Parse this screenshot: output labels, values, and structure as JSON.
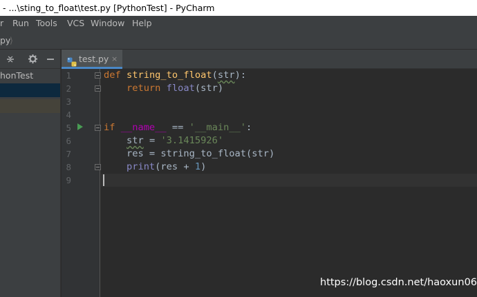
{
  "window": {
    "title": "- ...\\sting_to_float\\test.py [PythonTest] - PyCharm"
  },
  "menu": {
    "items": [
      "r",
      "Run",
      "Tools",
      "VCS",
      "Window",
      "Help"
    ]
  },
  "navbar": {
    "crumb": "py",
    "separator": "⟩"
  },
  "project": {
    "toolbar_icons": [
      "split-icon",
      "gear-icon",
      "minimize-icon"
    ],
    "root_label": "honTest"
  },
  "editor": {
    "tab_label": "test.py",
    "tab_close": "×",
    "line_numbers": [
      "1",
      "2",
      "3",
      "4",
      "5",
      "6",
      "7",
      "8",
      "9"
    ],
    "code": {
      "l1": {
        "kw": "def",
        "fn": "string_to_float",
        "p1": "(",
        "param": "str",
        "p2": "):"
      },
      "l2": {
        "kw": "return",
        "bi": "float",
        "rest": "(str)"
      },
      "l5": {
        "kw": "if",
        "dunder": "__name__",
        "op": " == ",
        "str": "'__main__'",
        "colon": ":"
      },
      "l6": {
        "var": "str",
        "op": " = ",
        "str": "'3.1415926'"
      },
      "l7": {
        "text": "res = string_to_float(str)"
      },
      "l8": {
        "bi": "print",
        "a": "(res + ",
        "num": "1",
        "b": ")"
      }
    }
  },
  "watermark": "https://blog.csdn.net/haoxun06",
  "colors": {
    "keyword": "#cc7832",
    "function": "#ffc66d",
    "builtin": "#8888c6",
    "string": "#6a8759",
    "number": "#6897bb",
    "dunder": "#b200b2",
    "text": "#a9b7c6",
    "background": "#2b2b2b",
    "run_arrow": "#499c54"
  }
}
